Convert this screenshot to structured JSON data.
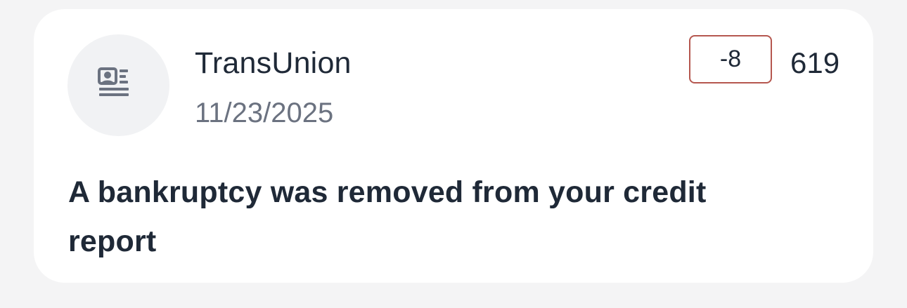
{
  "card": {
    "icon": "credit-report-icon",
    "bureau": "TransUnion",
    "date": "11/23/2025",
    "score_change": "-8",
    "score": "619",
    "message": "A bankruptcy was removed from your credit report"
  },
  "colors": {
    "background": "#f4f4f5",
    "card": "#ffffff",
    "avatar_bg": "#f1f2f4",
    "icon": "#6b7280",
    "text_primary": "#1f2937",
    "text_secondary": "#6b7280",
    "negative_badge_border": "#b5574f"
  }
}
